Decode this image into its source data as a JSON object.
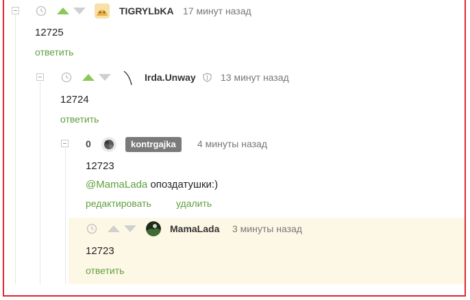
{
  "comments": [
    {
      "author": "TIGRYLbKA",
      "time": "17 минут назад",
      "text": "12725",
      "action": "ответить"
    },
    {
      "author": "Irda.Unway",
      "time": "13 минут назад",
      "text": "12724",
      "action": "ответить"
    },
    {
      "rating": "0",
      "author": "kontrgajka",
      "time": "4 минуты назад",
      "text": "12723",
      "mention": "@MamaLada",
      "reply_text": " опоздатушки:)",
      "actions": [
        "редактировать",
        "удалить"
      ]
    },
    {
      "author": "MamaLada",
      "time": "3 минуты назад",
      "text": "12723",
      "action": "ответить"
    }
  ],
  "colors": {
    "accent_green": "#5f9e3d",
    "upvote_active": "#8ac858",
    "highlight": "#fdf8e6",
    "frame": "#e0242c"
  },
  "icons": [
    "collapse-icon",
    "clock-icon",
    "upvote-icon",
    "downvote-icon",
    "shield-icon"
  ]
}
